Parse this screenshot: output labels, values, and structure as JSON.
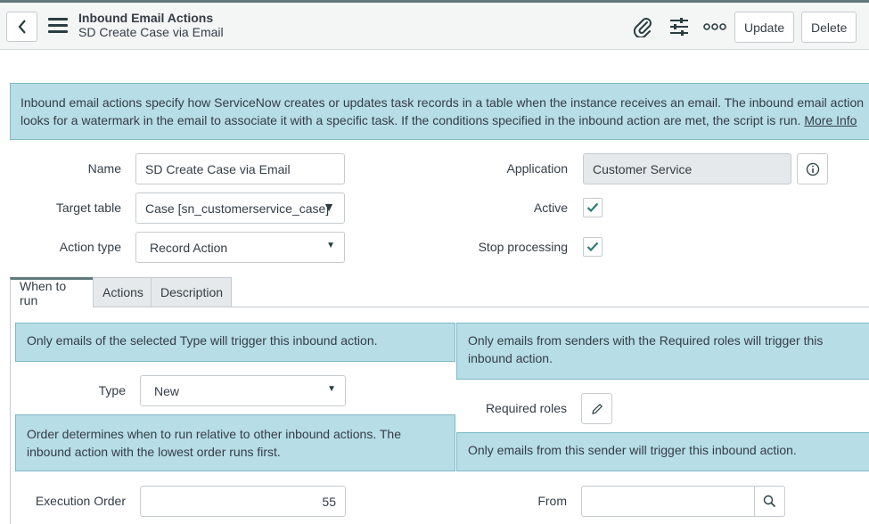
{
  "header": {
    "title": "Inbound Email Actions",
    "subtitle": "SD Create Case via Email",
    "back_icon": "chevron-left-icon",
    "menu_icon": "hamburger-icon",
    "attach_icon": "paperclip-icon",
    "settings_icon": "sliders-icon",
    "more_icon": "more-options-icon",
    "update_label": "Update",
    "delete_label": "Delete"
  },
  "banner": {
    "text": "Inbound email actions specify how ServiceNow creates or updates task records in a table when the instance receives an email. The inbound email action looks for a watermark in the email to associate it with a specific task. If the conditions specified in the inbound action are met, the script is run.",
    "link": "More Info"
  },
  "form": {
    "name_label": "Name",
    "name_value": "SD Create Case via Email",
    "target_table_label": "Target table",
    "target_table_value": "Case [sn_customerservice_case]",
    "action_type_label": "Action type",
    "action_type_value": "Record Action",
    "application_label": "Application",
    "application_value": "Customer Service",
    "active_label": "Active",
    "stop_processing_label": "Stop processing"
  },
  "tabs": [
    {
      "label": "When to run"
    },
    {
      "label": "Actions"
    },
    {
      "label": "Description"
    }
  ],
  "when_to_run": {
    "type_hint": "Only emails of the selected Type will trigger this inbound action.",
    "roles_hint": "Only emails from senders with the Required roles will trigger this inbound action.",
    "type_label": "Type",
    "type_value": "New",
    "required_roles_label": "Required roles",
    "order_hint": "Order determines when to run relative to other inbound actions. The inbound action with the lowest order runs first.",
    "from_hint": "Only emails from this sender will trigger this inbound action.",
    "execution_order_label": "Execution Order",
    "execution_order_value": "55",
    "from_label": "From",
    "from_value": ""
  },
  "colors": {
    "accent": "#5f7a78",
    "hint_bg": "#b7dde6",
    "check": "#2e7d76"
  }
}
